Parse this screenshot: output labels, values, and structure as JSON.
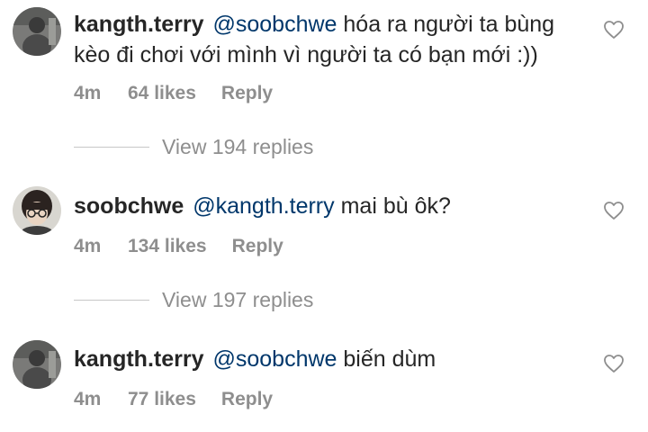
{
  "comments": [
    {
      "username": "kangth.terry",
      "mention": "@soobchwe",
      "text": "hóa ra người ta bùng kèo đi chơi với mình vì người ta có bạn mới :))",
      "time": "4m",
      "likes": "64 likes",
      "reply_label": "Reply",
      "view_replies": "View 194 replies"
    },
    {
      "username": "soobchwe",
      "mention": "@kangth.terry",
      "text": "mai bù ôk?",
      "time": "4m",
      "likes": "134 likes",
      "reply_label": "Reply",
      "view_replies": "View 197 replies"
    },
    {
      "username": "kangth.terry",
      "mention": "@soobchwe",
      "text": "biến dùm",
      "time": "4m",
      "likes": "77 likes",
      "reply_label": "Reply"
    }
  ],
  "colors": {
    "text": "#262626",
    "mention": "#00376b",
    "secondary": "#8e8e8e"
  },
  "icons": {
    "like": "heart-outline-icon"
  }
}
